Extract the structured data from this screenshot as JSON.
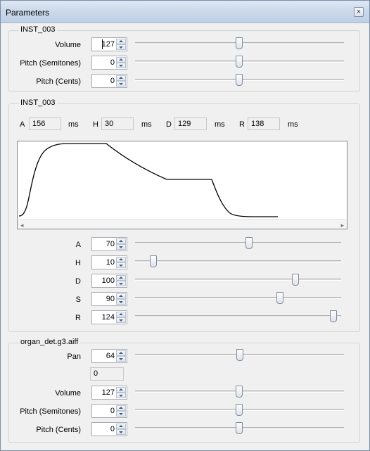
{
  "window": {
    "title": "Parameters",
    "close_glyph": "×"
  },
  "group1": {
    "label": "INST_003",
    "rows": [
      {
        "label": "Volume",
        "value": "127",
        "slider": 0.5
      },
      {
        "label": "Pitch (Semitones)",
        "value": "0",
        "slider": 0.5
      },
      {
        "label": "Pitch (Cents)",
        "value": "0",
        "slider": 0.5
      }
    ]
  },
  "group2": {
    "label": "INST_003",
    "readouts": [
      {
        "key": "A",
        "value": "156",
        "unit": "ms"
      },
      {
        "key": "H",
        "value": "30",
        "unit": "ms"
      },
      {
        "key": "D",
        "value": "129",
        "unit": "ms"
      },
      {
        "key": "R",
        "value": "138",
        "unit": "ms"
      }
    ],
    "envelope_scroll_left": "◂",
    "envelope_scroll_right": "▸",
    "rows": [
      {
        "label": "A",
        "value": "70",
        "slider": 0.55
      },
      {
        "label": "H",
        "value": "10",
        "slider": 0.09
      },
      {
        "label": "D",
        "value": "100",
        "slider": 0.78
      },
      {
        "label": "S",
        "value": "90",
        "slider": 0.7
      },
      {
        "label": "R",
        "value": "124",
        "slider": 0.97
      }
    ]
  },
  "group3": {
    "label": "organ_det.g3.aiff",
    "pan": {
      "label": "Pan",
      "value": "64",
      "slider": 0.5,
      "readout": "0"
    },
    "rows": [
      {
        "label": "Volume",
        "value": "127",
        "slider": 0.5
      },
      {
        "label": "Pitch (Semitones)",
        "value": "0",
        "slider": 0.5
      },
      {
        "label": "Pitch (Cents)",
        "value": "0",
        "slider": 0.5
      }
    ]
  },
  "colors": {
    "title_bar": "#c9d7ea",
    "window_bg": "#f0f0f0",
    "envelope_line": "#000000"
  }
}
